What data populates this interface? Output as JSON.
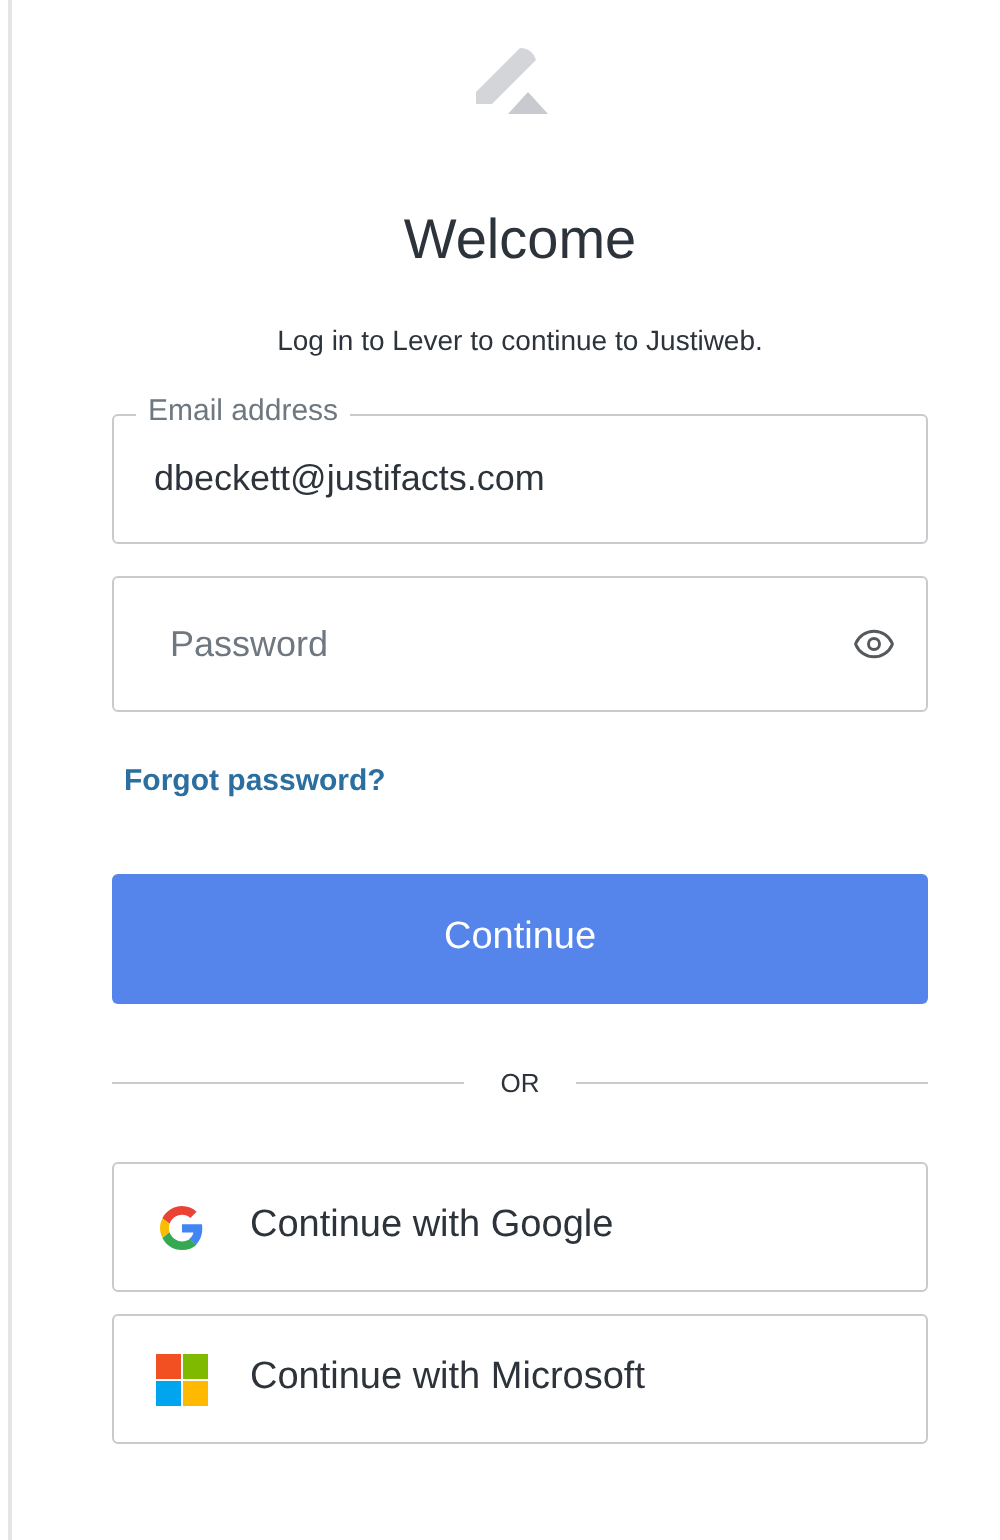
{
  "title": "Welcome",
  "subtitle": "Log in to Lever to continue to Justiweb.",
  "email": {
    "label": "Email address",
    "value": "dbeckett@justifacts.com"
  },
  "password": {
    "placeholder": "Password"
  },
  "forgot_link": "Forgot password?",
  "continue_button": "Continue",
  "divider": "OR",
  "social_buttons": [
    {
      "kind": "google",
      "label": "Continue with Google"
    },
    {
      "kind": "microsoft",
      "label": "Continue with Microsoft"
    }
  ]
}
